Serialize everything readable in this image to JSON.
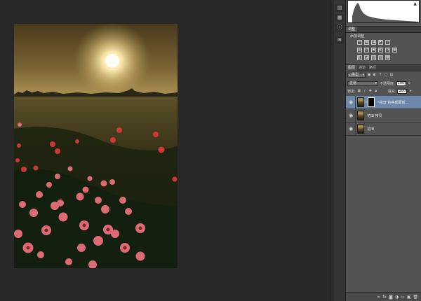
{
  "histogram": {
    "warning_icon": "warning-triangle-icon"
  },
  "adjustments": {
    "tabs": [
      "调整"
    ],
    "title": "添加调整",
    "row1": [
      "☼",
      "▦",
      "◪",
      "◩",
      "▽"
    ],
    "row2": [
      "▥",
      "⚖",
      "▣",
      "◐",
      "♻",
      "▦"
    ],
    "row3": [
      "◧",
      "◪",
      "▨",
      "▧",
      "▩"
    ]
  },
  "layers": {
    "tabs": [
      "图层",
      "通道",
      "路径"
    ],
    "filter_label": "ρ类型",
    "blend_mode": "正常",
    "opacity_label": "不透明度:",
    "opacity_value": "100%",
    "lock_label": "锁定:",
    "fill_label": "填充:",
    "fill_value": "100%",
    "items": [
      {
        "name": "\"花田\"的亮部蒙板...",
        "visible": true,
        "selected": true,
        "has_mask": true
      },
      {
        "name": "花田 拷贝",
        "visible": true,
        "selected": false,
        "has_mask": false
      },
      {
        "name": "花田",
        "visible": true,
        "selected": false,
        "has_mask": false
      }
    ]
  },
  "colors": {
    "workspace": "#282828",
    "panel": "#535353",
    "selected_layer": "#6d87aa"
  }
}
